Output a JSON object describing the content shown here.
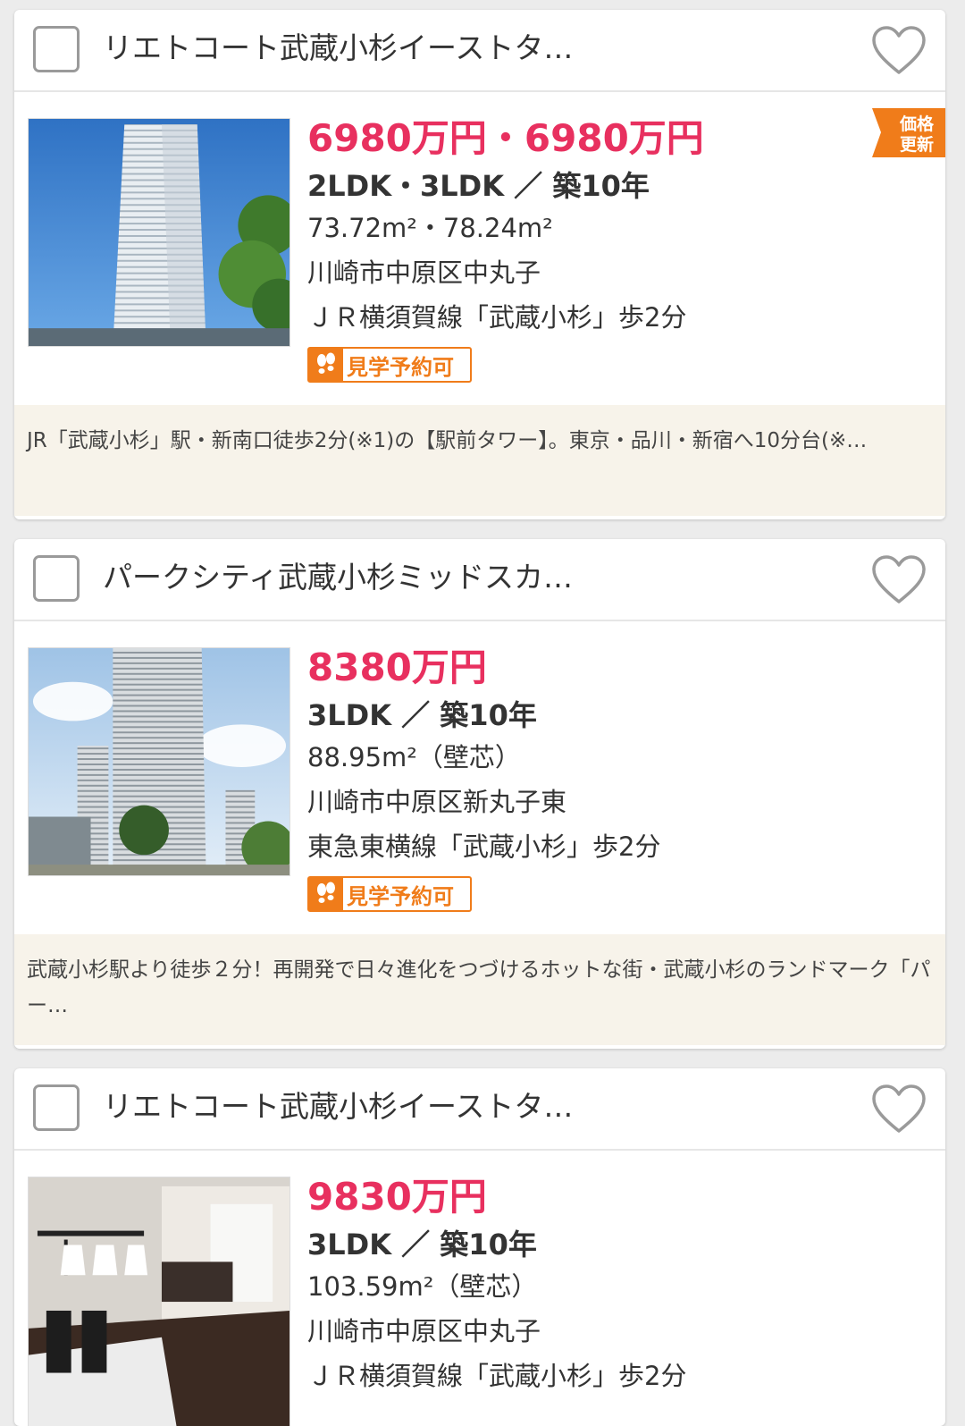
{
  "colors": {
    "price": "#e8305f",
    "accent": "#f07c1a",
    "desc_bg": "#f7f3ea"
  },
  "listings": [
    {
      "title": "リエトコート武蔵小杉イーストタ…",
      "price": "6980万円・6980万円",
      "layout": "2LDK・3LDK ／ 築10年",
      "area": "73.72m²・78.24m²",
      "address": "川崎市中原区中丸子",
      "access": "ＪＲ横須賀線「武蔵小杉」歩2分",
      "tour_badge": "見学予約可",
      "ribbon": [
        "価格",
        "更新"
      ],
      "description": "JR「武蔵小杉」駅・新南口徒歩2分(※1)の【駅前タワー】。東京・品川・新宿へ10分台(※…",
      "photo_icon": "tower-building-photo"
    },
    {
      "title": "パークシティ武蔵小杉ミッドスカ…",
      "price": "8380万円",
      "layout": "3LDK ／ 築10年",
      "area": "88.95m²（壁芯）",
      "address": "川崎市中原区新丸子東",
      "access": "東急東横線「武蔵小杉」歩2分",
      "tour_badge": "見学予約可",
      "description": "武蔵小杉駅より徒歩２分！再開発で日々進化をつづけるホットな街・武蔵小杉のランドマーク「パー…",
      "photo_icon": "tower-cluster-photo"
    },
    {
      "title": "リエトコート武蔵小杉イーストタ…",
      "price": "9830万円",
      "layout": "3LDK ／ 築10年",
      "area": "103.59m²（壁芯）",
      "address": "川崎市中原区中丸子",
      "access": "ＪＲ横須賀線「武蔵小杉」歩2分",
      "photo_icon": "living-room-photo"
    }
  ]
}
